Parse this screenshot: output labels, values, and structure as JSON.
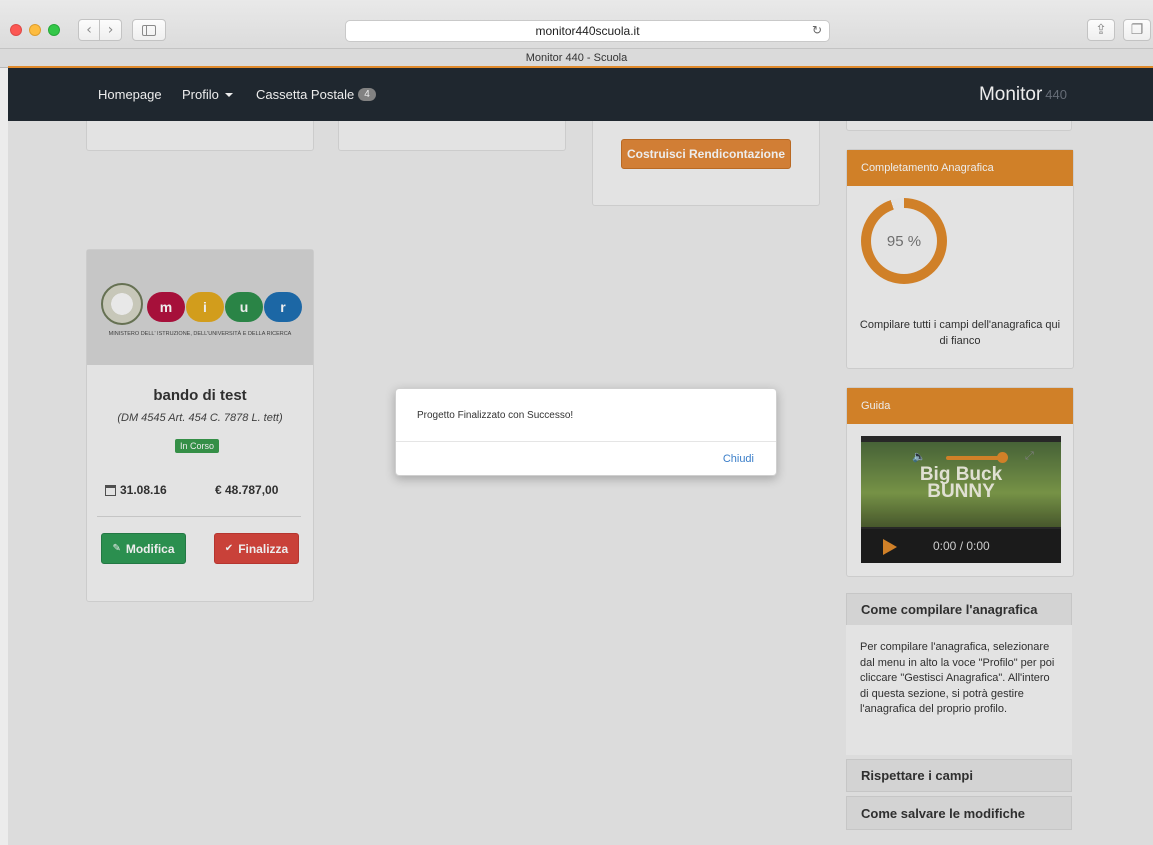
{
  "browser": {
    "url": "monitor440scuola.it",
    "tab_title": "Monitor 440 - Scuola"
  },
  "navbar": {
    "items": [
      {
        "label": "Homepage"
      },
      {
        "label": "Profilo"
      },
      {
        "label": "Cassetta Postale",
        "badge": "4"
      }
    ],
    "brand": "Monitor",
    "brand_suffix": "440"
  },
  "actions": {
    "build_report_label": "Costruisci Rendicontazione"
  },
  "project": {
    "logo_caption": "MINISTERO DELL' ISTRUZIONE, DELL'UNIVERSITÀ E DELLA RICERCA",
    "logo_letters": [
      "m",
      "i",
      "u",
      "r"
    ],
    "title": "bando di test",
    "subtitle": "(DM 4545 Art. 454 C. 7878 L. tett)",
    "status": "In Corso",
    "date": "31.08.16",
    "amount": "€ 48.787,00",
    "edit_label": "Modifica",
    "finalize_label": "Finalizza"
  },
  "completion": {
    "header": "Completamento Anagrafica",
    "percent_label": "95 %",
    "percent_value": 0.95,
    "text": "Compilare tutti i campi dell'anagrafica qui di fianco"
  },
  "guide": {
    "header": "Guida",
    "video_title_line1": "Big Buck",
    "video_title_line2": "BUNNY",
    "time": "0:00  /  0:00",
    "volume": 0.9
  },
  "accordion": {
    "item1_title": "Come compilare l'anagrafica",
    "item1_body": "Per compilare l'anagrafica, selezionare dal menu in alto la voce \"Profilo\" per poi cliccare \"Gestisci Anagrafica\". All'intero di questa sezione, si potrà gestire l'anagrafica del proprio profilo.",
    "item2_title": "Rispettare i campi",
    "item3_title": "Come salvare le modifiche"
  },
  "modal": {
    "message": "Progetto Finalizzato con Successo!",
    "close_label": "Chiudi"
  }
}
